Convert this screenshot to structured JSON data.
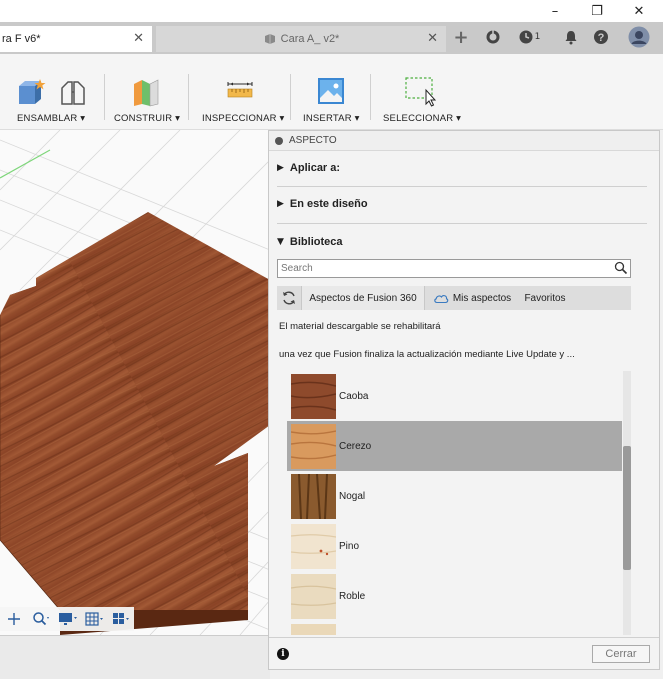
{
  "window": {
    "minimize_glyph": "–",
    "restore_glyph": "❐",
    "close_glyph": "✕"
  },
  "tabs": {
    "active_label": "ra F v6*",
    "inactive_label": "Cara A_ v2*",
    "close_glyph": "✕"
  },
  "header_icons": {
    "add": "+",
    "jobs_count": "1"
  },
  "toolbar": {
    "assemble": "ENSAMBLAR ▾",
    "construct": "CONSTRUIR ▾",
    "inspect": "INSPECCIONAR ▾",
    "insert": "INSERTAR ▾",
    "select": "SELECCIONAR ▾"
  },
  "panel": {
    "title": "ASPECTO",
    "apply_to": "Aplicar a:",
    "in_design": "En este diseño",
    "library": "Biblioteca",
    "search_placeholder": "Search",
    "lib_tabs": {
      "fusion": "Aspectos de Fusion 360",
      "mine": "Mis aspectos",
      "favorites": "Favoritos"
    },
    "message_line1": "El material descargable se rehabilitará",
    "message_line2": "una vez que Fusion finaliza la actualización mediante Live Update y ...",
    "materials": [
      {
        "name": "Caoba",
        "selected": false
      },
      {
        "name": "Cerezo",
        "selected": true
      },
      {
        "name": "Nogal",
        "selected": false
      },
      {
        "name": "Pino",
        "selected": false
      },
      {
        "name": "Roble",
        "selected": false
      }
    ],
    "close_button": "Cerrar"
  },
  "colors": {
    "wood_top": "#8a4326",
    "wood_side": "#5e2a14",
    "selection": "#a9a9a9",
    "nav_blue": "#2a5d9e"
  }
}
